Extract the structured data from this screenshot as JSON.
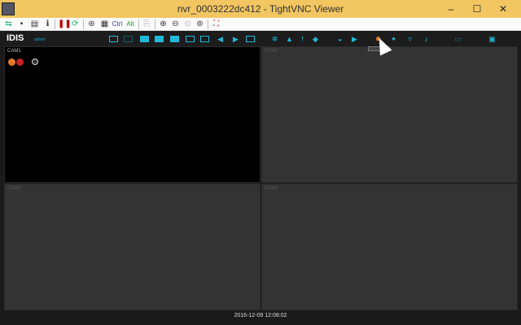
{
  "window": {
    "title": "nvr_0003222dc412 - TightVNC Viewer",
    "minimize": "–",
    "maximize": "☐",
    "close": "✕"
  },
  "vnc_toolbar": {
    "ctrl": "Ctrl",
    "alt": "Alt"
  },
  "nvr": {
    "logo": "IDIS",
    "user": "admin",
    "tooltip": "",
    "colors": {
      "accent": "#22b8d8"
    }
  },
  "cameras": [
    "CAM1",
    "CAM2",
    "CAM3",
    "CAM4"
  ],
  "status": {
    "timestamp": "2016-12-09  12:08:02"
  }
}
